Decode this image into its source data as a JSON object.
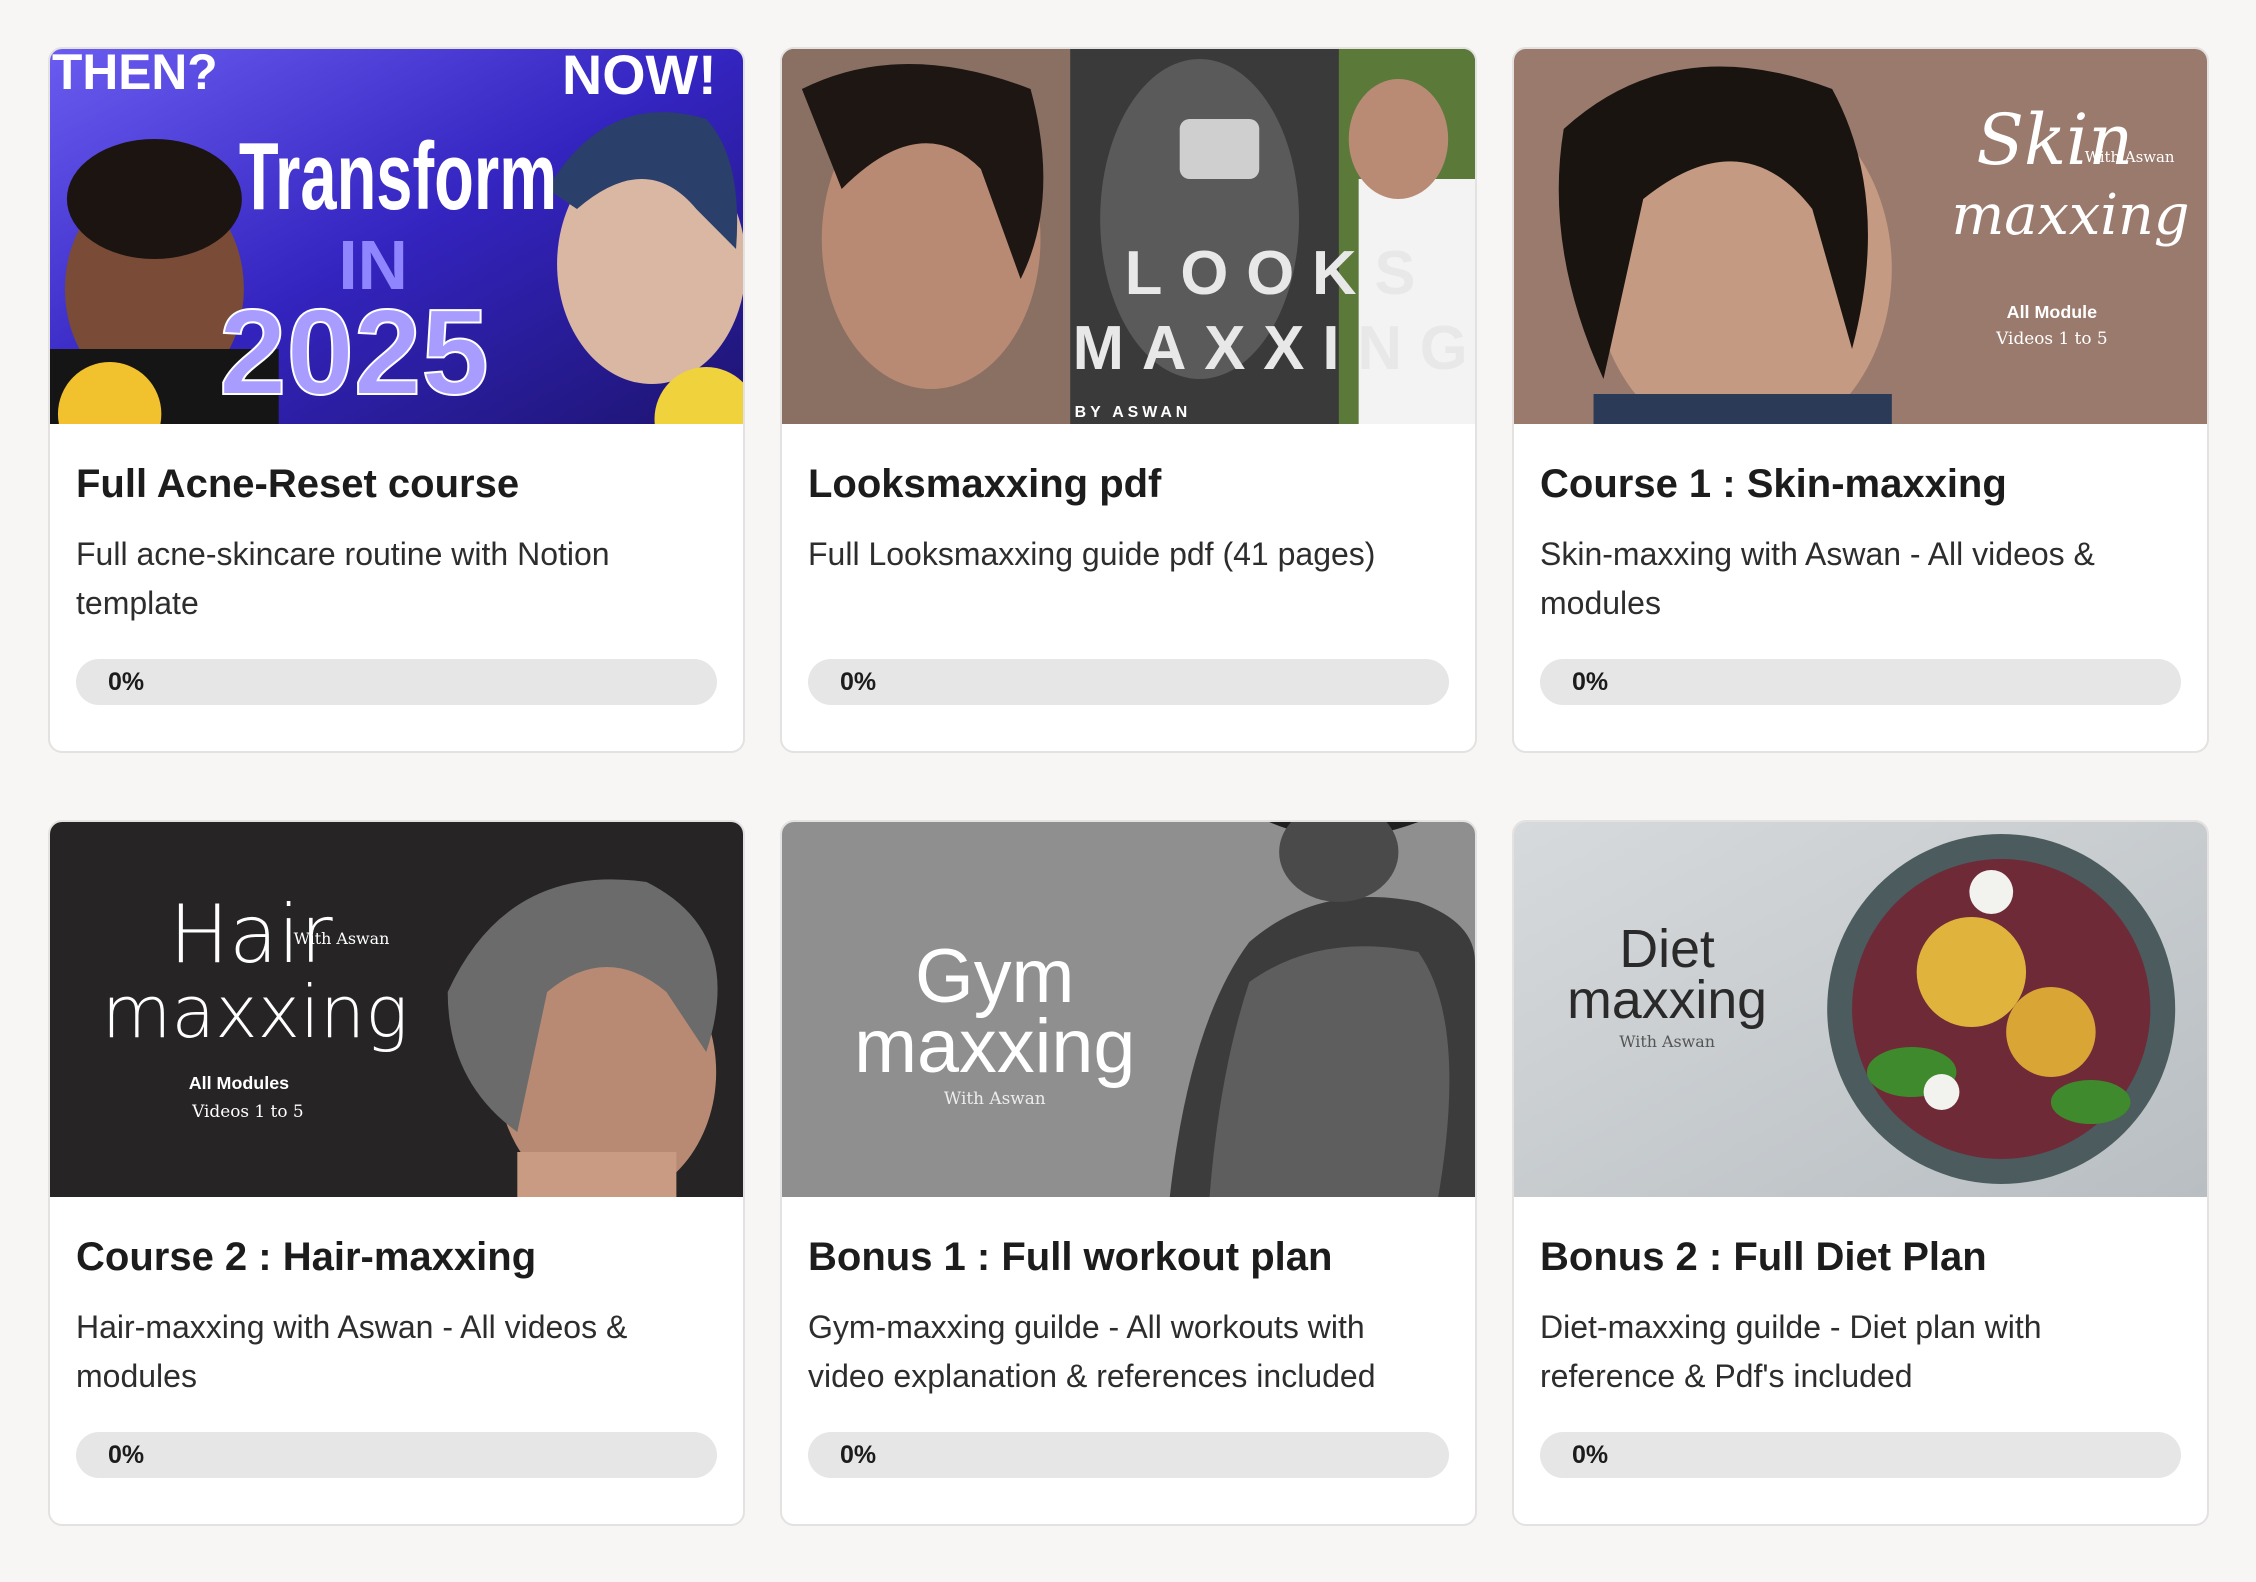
{
  "courses": [
    {
      "title": "Full Acne-Reset course",
      "description": "Full acne-skincare routine with Notion template",
      "progress_label": "0%",
      "progress": 0,
      "thumb": {
        "then": "THEN?",
        "now": "NOW!",
        "line1": "Transform",
        "line2": "IN",
        "line3": "2025"
      }
    },
    {
      "title": "Looksmaxxing pdf",
      "description": "Full Looksmaxxing guide pdf (41 pages)",
      "progress_label": "0%",
      "progress": 0,
      "thumb": {
        "line1": "LOOKS",
        "line2": "MAXXING",
        "byline": "BY ASWAN"
      }
    },
    {
      "title": "Course 1 : Skin-maxxing",
      "description": "Skin-maxxing with Aswan - All videos & modules",
      "progress_label": "0%",
      "progress": 0,
      "thumb": {
        "line1": "Skin",
        "line2": "maxxing",
        "with": "With Aswan",
        "sub1": "All Module",
        "sub2": "Videos 1 to 5"
      }
    },
    {
      "title": "Course 2 : Hair-maxxing",
      "description": "Hair-maxxing with Aswan - All videos & modules",
      "progress_label": "0%",
      "progress": 0,
      "thumb": {
        "line1": "Hair",
        "line2": "maxxing",
        "with": "With Aswan",
        "sub1": "All Modules",
        "sub2": "Videos 1 to 5"
      }
    },
    {
      "title": "Bonus 1 : Full workout plan",
      "description": "Gym-maxxing guilde - All workouts with video explanation & references included",
      "progress_label": "0%",
      "progress": 0,
      "thumb": {
        "line1": "Gym",
        "line2": "maxxing",
        "with": "With Aswan"
      }
    },
    {
      "title": "Bonus 2 : Full Diet Plan",
      "description": "Diet-maxxing guilde - Diet plan with reference & Pdf's included",
      "progress_label": "0%",
      "progress": 0,
      "thumb": {
        "line1": "Diet",
        "line2": "maxxing",
        "with": "With Aswan"
      }
    }
  ],
  "colors": {
    "page_bg": "#f7f6f5",
    "card_bg": "#ffffff",
    "progress_track": "#e6e6e6",
    "thumb_acne_bg": "#3b2fc9",
    "thumb_looks_bg": "#262626",
    "thumb_skin_bg": "#9a7a6c",
    "thumb_hair_bg": "#262424",
    "thumb_gym_bg": "#8f8f8f",
    "thumb_diet_bg": "#c9cdd0"
  }
}
